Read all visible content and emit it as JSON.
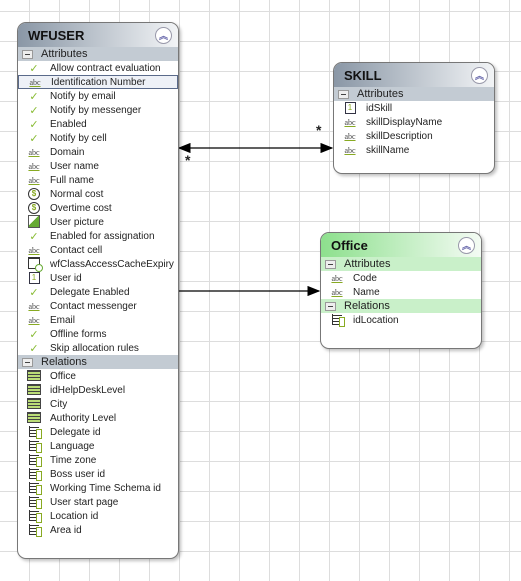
{
  "entities": {
    "wfuser": {
      "title": "WFUSER",
      "attributes_label": "Attributes",
      "relations_label": "Relations",
      "attributes": [
        {
          "label": "Allow contract evaluation",
          "icon": "check"
        },
        {
          "label": "Identification Number",
          "icon": "abc",
          "selected": true
        },
        {
          "label": "Notify by email",
          "icon": "check"
        },
        {
          "label": "Notify by messenger",
          "icon": "check"
        },
        {
          "label": "Enabled",
          "icon": "check"
        },
        {
          "label": "Notify by cell",
          "icon": "check"
        },
        {
          "label": "Domain",
          "icon": "abc"
        },
        {
          "label": "User name",
          "icon": "abc"
        },
        {
          "label": "Full name",
          "icon": "abc"
        },
        {
          "label": "Normal cost",
          "icon": "dollar"
        },
        {
          "label": "Overtime cost",
          "icon": "dollar"
        },
        {
          "label": "User picture",
          "icon": "picture"
        },
        {
          "label": "Enabled for assignation",
          "icon": "check"
        },
        {
          "label": "Contact cell",
          "icon": "abc"
        },
        {
          "label": "wfClassAccessCacheExpiry",
          "icon": "datetime"
        },
        {
          "label": "User id",
          "icon": "number"
        },
        {
          "label": "Delegate Enabled",
          "icon": "check"
        },
        {
          "label": "Contact messenger",
          "icon": "abc"
        },
        {
          "label": "Email",
          "icon": "abc"
        },
        {
          "label": "Offline forms",
          "icon": "check"
        },
        {
          "label": "Skip allocation rules",
          "icon": "check"
        }
      ],
      "relations": [
        {
          "label": "Office",
          "icon": "table"
        },
        {
          "label": "idHelpDeskLevel",
          "icon": "table"
        },
        {
          "label": "City",
          "icon": "table"
        },
        {
          "label": "Authority Level",
          "icon": "table"
        },
        {
          "label": "Delegate id",
          "icon": "relation"
        },
        {
          "label": "Language",
          "icon": "relation"
        },
        {
          "label": "Time zone",
          "icon": "relation"
        },
        {
          "label": "Boss user id",
          "icon": "relation"
        },
        {
          "label": "Working Time Schema id",
          "icon": "relation"
        },
        {
          "label": "User start page",
          "icon": "relation"
        },
        {
          "label": "Location id",
          "icon": "relation"
        },
        {
          "label": "Area id",
          "icon": "relation"
        }
      ]
    },
    "skill": {
      "title": "SKILL",
      "attributes_label": "Attributes",
      "attributes": [
        {
          "label": "idSkill",
          "icon": "number"
        },
        {
          "label": "skillDisplayName",
          "icon": "abc"
        },
        {
          "label": "skillDescription",
          "icon": "abc"
        },
        {
          "label": "skillName",
          "icon": "abc"
        }
      ]
    },
    "office": {
      "title": "Office",
      "attributes_label": "Attributes",
      "relations_label": "Relations",
      "attributes": [
        {
          "label": "Code",
          "icon": "abc"
        },
        {
          "label": "Name",
          "icon": "abc"
        }
      ],
      "relations": [
        {
          "label": "idLocation",
          "icon": "relation"
        }
      ]
    }
  },
  "connectors": {
    "wfuser_skill": {
      "end_a": "*",
      "end_b": "*"
    }
  },
  "colors": {
    "header_gray": "#8a97a6",
    "header_green": "#8de08d",
    "accent_green": "#88aa22"
  }
}
